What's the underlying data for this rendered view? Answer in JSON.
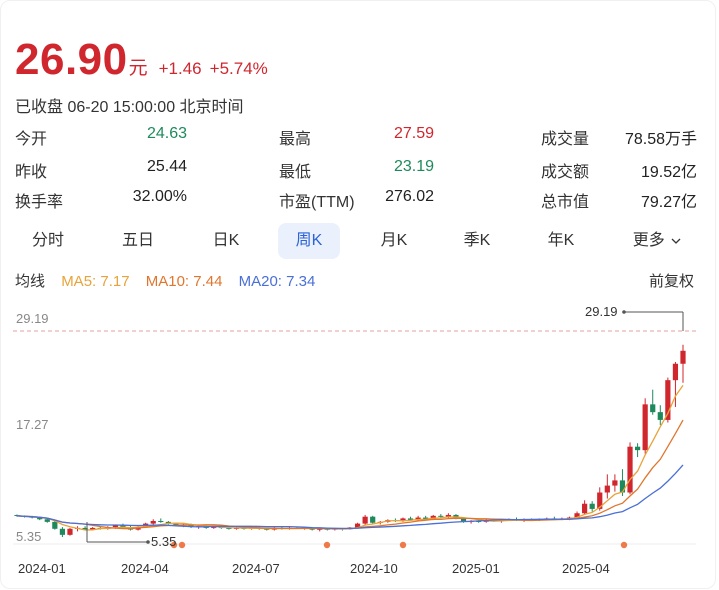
{
  "quote": {
    "price": "26.90",
    "unit": "元",
    "change": "+1.46",
    "change_pct": "+5.74%",
    "status": "已收盘 06-20 15:00:00 北京时间"
  },
  "stats": [
    {
      "label": "今开",
      "value": "24.63",
      "color": "green"
    },
    {
      "label": "最高",
      "value": "27.59",
      "color": "red"
    },
    {
      "label": "成交量",
      "value": "78.58万手",
      "color": "dark"
    },
    {
      "label": "昨收",
      "value": "25.44",
      "color": "dark"
    },
    {
      "label": "最低",
      "value": "23.19",
      "color": "green"
    },
    {
      "label": "成交额",
      "value": "19.52亿",
      "color": "dark"
    },
    {
      "label": "换手率",
      "value": "32.00%",
      "color": "dark"
    },
    {
      "label": "市盈(TTM)",
      "value": "276.02",
      "color": "dark"
    },
    {
      "label": "总市值",
      "value": "79.27亿",
      "color": "dark"
    }
  ],
  "tabs": [
    "分时",
    "五日",
    "日K",
    "周K",
    "月K",
    "季K",
    "年K",
    "更多"
  ],
  "active_tab": "周K",
  "ma": {
    "label": "均线",
    "ma5": "MA5: 7.17",
    "ma10": "MA10: 7.44",
    "ma20": "MA20: 7.34",
    "adjust": "前复权"
  },
  "colors": {
    "up": "#d0262e",
    "down": "#1e8a5c",
    "ma5": "#e8a33a",
    "ma10": "#e0762e",
    "ma20": "#4a6fd6",
    "accent": "#2d63d6"
  },
  "chart_data": {
    "type": "candlestick",
    "y_ticks": [
      "29.19",
      "17.27",
      "5.35"
    ],
    "x_ticks": [
      "2024-01",
      "2024-04",
      "2024-07",
      "2024-10",
      "2025-01",
      "2025-04"
    ],
    "ylim": [
      5.35,
      29.19
    ],
    "max_marker": "29.19",
    "min_marker": "5.35",
    "candles": [
      [
        7.9,
        7.95,
        7.7,
        7.8
      ],
      [
        7.8,
        7.85,
        7.6,
        7.7
      ],
      [
        7.7,
        7.8,
        7.5,
        7.6
      ],
      [
        7.6,
        7.65,
        7.3,
        7.4
      ],
      [
        7.4,
        7.5,
        7.0,
        7.1
      ],
      [
        7.1,
        7.2,
        6.2,
        6.3
      ],
      [
        6.3,
        6.5,
        5.35,
        5.6
      ],
      [
        5.6,
        6.4,
        5.5,
        6.3
      ],
      [
        6.3,
        6.6,
        6.0,
        6.4
      ],
      [
        6.4,
        6.6,
        6.1,
        6.2
      ],
      [
        6.2,
        6.5,
        6.1,
        6.4
      ],
      [
        6.4,
        6.6,
        6.2,
        6.3
      ],
      [
        6.3,
        6.6,
        6.2,
        6.5
      ],
      [
        6.5,
        6.8,
        6.3,
        6.7
      ],
      [
        6.7,
        6.9,
        6.4,
        6.5
      ],
      [
        6.5,
        6.7,
        6.1,
        6.2
      ],
      [
        6.2,
        6.6,
        6.1,
        6.5
      ],
      [
        6.5,
        7.0,
        6.4,
        6.9
      ],
      [
        6.9,
        7.4,
        6.8,
        7.2
      ],
      [
        7.2,
        7.5,
        7.0,
        7.1
      ],
      [
        7.1,
        7.2,
        6.8,
        6.9
      ],
      [
        6.9,
        7.0,
        6.6,
        6.7
      ],
      [
        6.7,
        6.9,
        6.5,
        6.8
      ],
      [
        6.8,
        6.9,
        6.4,
        6.5
      ],
      [
        6.5,
        6.7,
        6.3,
        6.6
      ],
      [
        6.6,
        6.7,
        6.3,
        6.4
      ],
      [
        6.4,
        6.6,
        6.3,
        6.5
      ],
      [
        6.5,
        6.6,
        6.3,
        6.4
      ],
      [
        6.4,
        6.5,
        6.2,
        6.3
      ],
      [
        6.3,
        6.5,
        6.2,
        6.4
      ],
      [
        6.4,
        6.5,
        6.2,
        6.3
      ],
      [
        6.3,
        6.5,
        6.2,
        6.4
      ],
      [
        6.4,
        6.5,
        6.2,
        6.3
      ],
      [
        6.3,
        6.4,
        6.1,
        6.2
      ],
      [
        6.2,
        6.5,
        6.1,
        6.4
      ],
      [
        6.4,
        6.5,
        6.2,
        6.3
      ],
      [
        6.3,
        6.5,
        6.2,
        6.4
      ],
      [
        6.4,
        6.5,
        6.3,
        6.35
      ],
      [
        6.35,
        6.5,
        6.2,
        6.45
      ],
      [
        6.45,
        6.5,
        6.1,
        6.2
      ],
      [
        6.2,
        6.4,
        6.0,
        6.3
      ],
      [
        6.3,
        6.4,
        6.1,
        6.2
      ],
      [
        6.2,
        6.4,
        6.1,
        6.35
      ],
      [
        6.35,
        6.4,
        6.1,
        6.25
      ],
      [
        6.25,
        6.5,
        6.2,
        6.45
      ],
      [
        6.45,
        7.0,
        6.4,
        6.9
      ],
      [
        6.9,
        7.9,
        6.8,
        7.7
      ],
      [
        7.7,
        7.8,
        6.9,
        7.0
      ],
      [
        7.0,
        7.2,
        6.8,
        7.1
      ],
      [
        7.1,
        7.4,
        7.0,
        7.3
      ],
      [
        7.3,
        7.5,
        7.1,
        7.2
      ],
      [
        7.2,
        7.6,
        7.1,
        7.5
      ],
      [
        7.5,
        7.7,
        7.2,
        7.3
      ],
      [
        7.3,
        7.8,
        7.2,
        7.6
      ],
      [
        7.6,
        7.8,
        7.3,
        7.4
      ],
      [
        7.4,
        7.9,
        7.3,
        7.8
      ],
      [
        7.8,
        8.0,
        7.6,
        7.7
      ],
      [
        7.7,
        8.1,
        7.5,
        7.9
      ],
      [
        7.9,
        8.0,
        7.4,
        7.5
      ],
      [
        7.5,
        7.6,
        7.0,
        7.1
      ],
      [
        7.1,
        7.3,
        6.9,
        7.2
      ],
      [
        7.2,
        7.4,
        7.0,
        7.1
      ],
      [
        7.1,
        7.4,
        7.0,
        7.3
      ],
      [
        7.3,
        7.5,
        7.1,
        7.2
      ],
      [
        7.2,
        7.4,
        7.0,
        7.3
      ],
      [
        7.3,
        7.5,
        7.2,
        7.4
      ],
      [
        7.4,
        7.6,
        7.2,
        7.3
      ],
      [
        7.3,
        7.5,
        7.1,
        7.4
      ],
      [
        7.4,
        7.5,
        7.2,
        7.3
      ],
      [
        7.3,
        7.5,
        7.2,
        7.4
      ],
      [
        7.4,
        7.6,
        7.3,
        7.5
      ],
      [
        7.5,
        7.7,
        7.3,
        7.4
      ],
      [
        7.4,
        7.6,
        7.3,
        7.5
      ],
      [
        7.5,
        7.7,
        7.3,
        7.6
      ],
      [
        7.6,
        8.3,
        7.5,
        8.1
      ],
      [
        8.1,
        9.6,
        8.0,
        9.2
      ],
      [
        9.2,
        9.5,
        8.3,
        8.6
      ],
      [
        8.6,
        11.1,
        8.4,
        10.5
      ],
      [
        10.5,
        12.6,
        9.8,
        11.3
      ],
      [
        11.3,
        12.6,
        10.6,
        11.9
      ],
      [
        11.9,
        13.2,
        10.1,
        10.5
      ],
      [
        10.5,
        16.3,
        10.3,
        15.8
      ],
      [
        15.8,
        16.2,
        14.6,
        15.4
      ],
      [
        15.4,
        21.4,
        15.0,
        20.7
      ],
      [
        20.7,
        22.4,
        19.5,
        19.8
      ],
      [
        19.8,
        20.6,
        18.3,
        18.9
      ],
      [
        18.9,
        23.8,
        18.6,
        23.5
      ],
      [
        23.5,
        25.6,
        20.4,
        25.4
      ],
      [
        25.4,
        27.6,
        23.2,
        26.9
      ]
    ]
  }
}
